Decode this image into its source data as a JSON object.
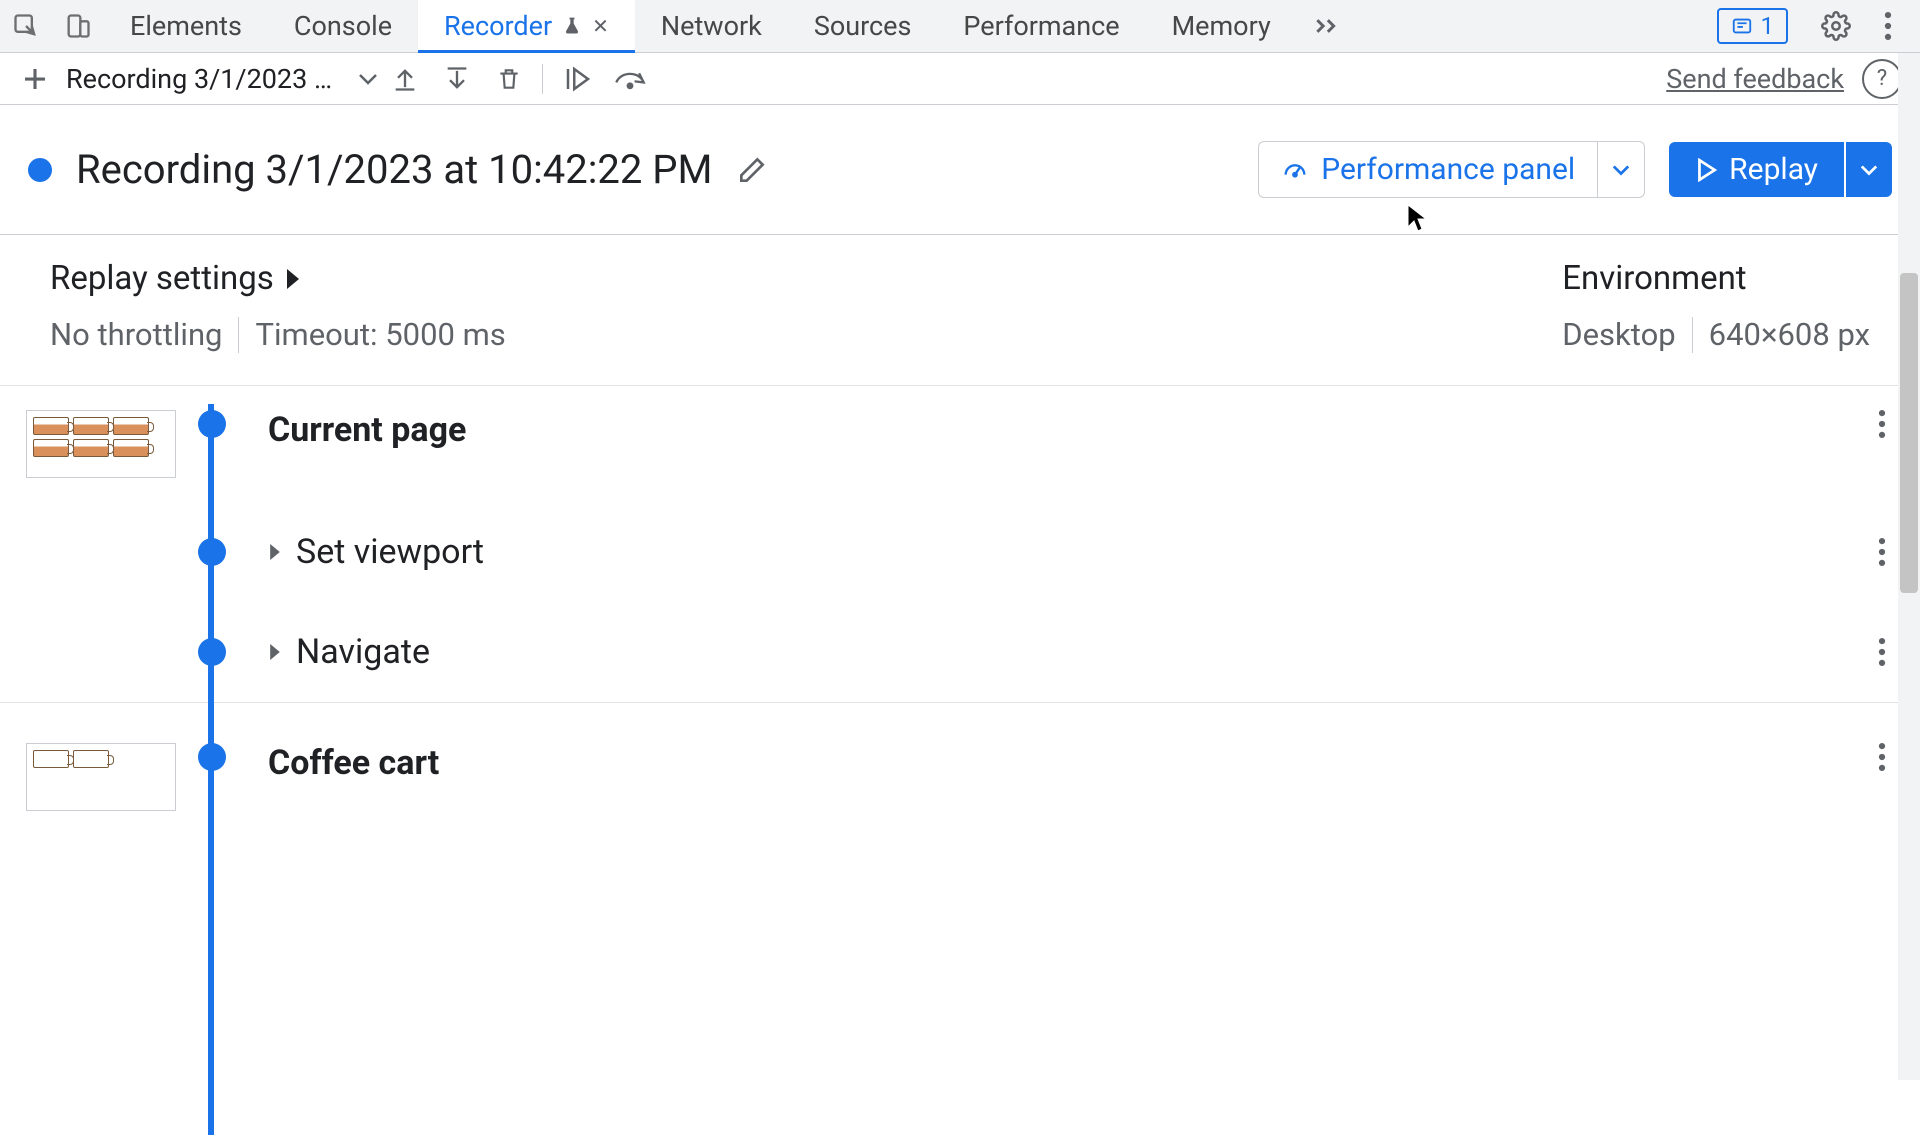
{
  "tabs": {
    "elements": "Elements",
    "console": "Console",
    "recorder": "Recorder",
    "network": "Network",
    "sources": "Sources",
    "performance": "Performance",
    "memory": "Memory"
  },
  "issues_count": "1",
  "toolbar": {
    "recording_picker": "Recording 3/1/2023 at 10…",
    "feedback": "Send feedback",
    "help": "?"
  },
  "recording": {
    "title": "Recording 3/1/2023 at 10:42:22 PM",
    "performance_panel": "Performance panel",
    "replay": "Replay"
  },
  "settings": {
    "heading": "Replay settings",
    "throttle": "No throttling",
    "timeout": "Timeout: 5000 ms"
  },
  "environment": {
    "heading": "Environment",
    "device": "Desktop",
    "viewport": "640×608 px"
  },
  "steps": {
    "s0": "Current page",
    "s1": "Set viewport",
    "s2": "Navigate",
    "s3": "Coffee cart"
  }
}
